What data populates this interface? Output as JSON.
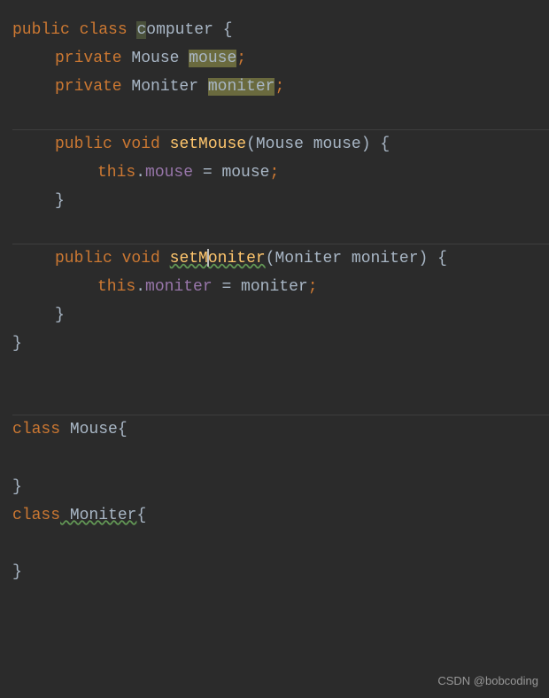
{
  "code": {
    "line1_public": "public",
    "line1_class": "class",
    "line1_name": "computer",
    "line1_brace": " {",
    "line1_c": "c",
    "line1_omputer": "omputer",
    "line2_private": "private",
    "line2_type": " Mouse ",
    "line2_field": "mouse",
    "line2_semi": ";",
    "line3_private": "private",
    "line3_type": " Moniter ",
    "line3_field": "moniter",
    "line3_semi": ";",
    "line5_public": "public",
    "line5_void": "void",
    "line5_method": "setMouse",
    "line5_params": "(Mouse mouse)",
    "line5_brace": " {",
    "line6_this": "this",
    "line6_dot": ".",
    "line6_field": "mouse",
    "line6_eq": " = mouse",
    "line6_semi": ";",
    "line7_brace": "}",
    "line9_public": "public",
    "line9_void": "void",
    "line9_method_a": "setM",
    "line9_method_b": "oniter",
    "line9_params": "(Moniter moniter)",
    "line9_brace": " {",
    "line10_this": "this",
    "line10_dot": ".",
    "line10_field": "moniter",
    "line10_eq": " = moniter",
    "line10_semi": ";",
    "line11_brace": "}",
    "line12_brace": "}",
    "line14_class": "class",
    "line14_name": " Mouse",
    "line14_brace": "{",
    "line16_brace": "}",
    "line17_class": "class",
    "line17_name": " Moniter",
    "line17_brace": "{",
    "line19_brace": "}"
  },
  "watermark": "CSDN @bobcoding"
}
